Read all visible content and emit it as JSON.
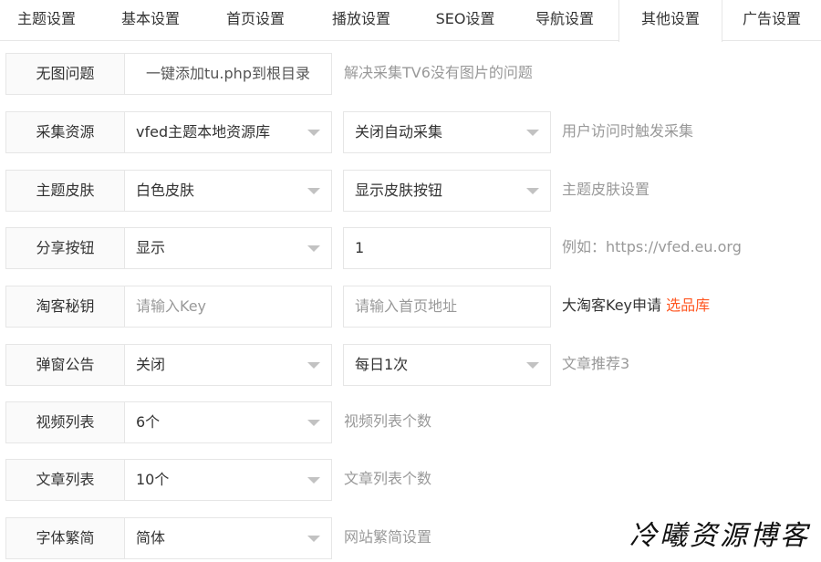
{
  "tabs": [
    {
      "label": "主题设置"
    },
    {
      "label": "基本设置"
    },
    {
      "label": "首页设置"
    },
    {
      "label": "播放设置"
    },
    {
      "label": "SEO设置"
    },
    {
      "label": "导航设置"
    },
    {
      "label": "其他设置",
      "active": true
    },
    {
      "label": "广告设置"
    }
  ],
  "rows": [
    {
      "label": "无图问题",
      "button": "一键添加tu.php到根目录",
      "hint": "解决采集TV6没有图片的问题"
    },
    {
      "label": "采集资源",
      "select1": "vfed主题本地资源库",
      "select2": "关闭自动采集",
      "hint": "用户访问时触发采集"
    },
    {
      "label": "主题皮肤",
      "select1": "白色皮肤",
      "select2": "显示皮肤按钮",
      "hint": "主题皮肤设置"
    },
    {
      "label": "分享按钮",
      "select1": "显示",
      "input2_value": "1",
      "hint": "例如：https://vfed.eu.org"
    },
    {
      "label": "淘客秘钥",
      "input1_placeholder": "请输入Key",
      "input2_placeholder": "请输入首页地址",
      "hint": "大淘客Key申请",
      "hint_link": "选品库"
    },
    {
      "label": "弹窗公告",
      "select1": "关闭",
      "select2": "每日1次",
      "hint": "文章推荐3"
    },
    {
      "label": "视频列表",
      "select1": "6个",
      "hint": "视频列表个数"
    },
    {
      "label": "文章列表",
      "select1": "10个",
      "hint": "文章列表个数"
    },
    {
      "label": "字体繁简",
      "select1": "简体",
      "hint": "网站繁简设置"
    }
  ],
  "watermark": "冷曦资源博客",
  "colors": {
    "accent_link": "#ff5722",
    "border": "#e6e6e6",
    "label_bg": "#fafafa",
    "hint": "#999999"
  }
}
